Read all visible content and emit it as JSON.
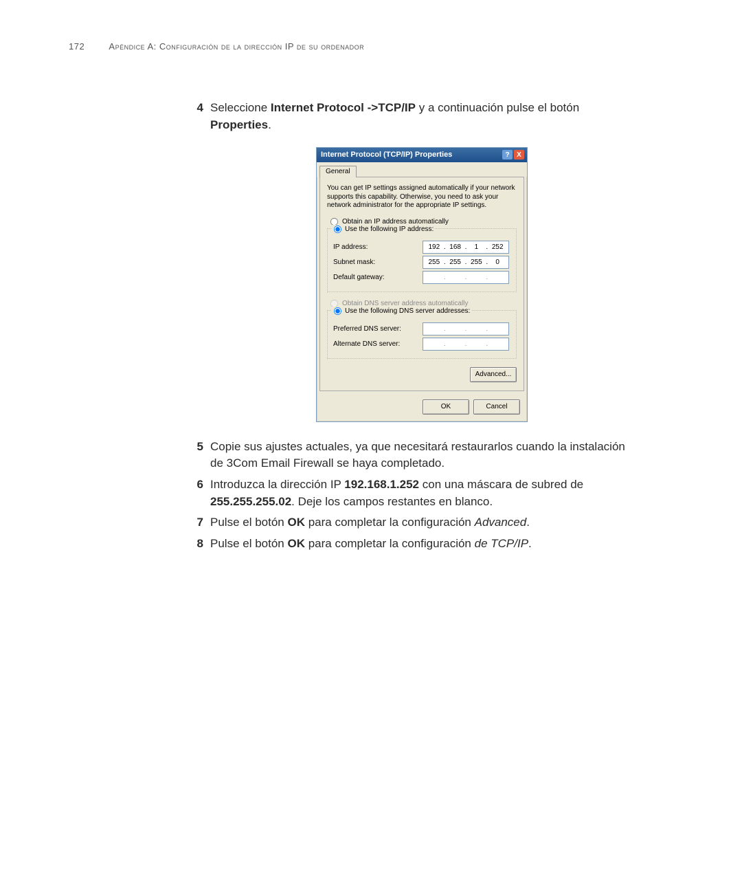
{
  "header": {
    "page_number": "172",
    "title": "Apéndice A: Configuración de la dirección IP de su ordenador"
  },
  "steps": {
    "s4": {
      "num": "4",
      "pre": "Seleccione ",
      "bold1": "Internet Protocol ->TCP/IP",
      "mid": " y a continuación pulse el botón ",
      "bold2": "Properties",
      "post": "."
    },
    "s5": {
      "num": "5",
      "text": "Copie sus ajustes actuales, ya que necesitará restaurarlos cuando la instalación de 3Com Email Firewall se haya completado."
    },
    "s6": {
      "num": "6",
      "pre": "Introduzca la dirección IP ",
      "bold1": "192.168.1.252",
      "mid": " con una máscara de subred de ",
      "bold2": "255.255.255.02",
      "post": ". Deje los campos restantes en blanco."
    },
    "s7": {
      "num": "7",
      "pre": "Pulse el botón ",
      "bold": "OK",
      "mid": " para completar la configuración ",
      "ital": "Advanced",
      "post": "."
    },
    "s8": {
      "num": "8",
      "pre": "Pulse el botón ",
      "bold": "OK",
      "mid": " para completar la configuración ",
      "ital": "de TCP/IP",
      "post": "."
    }
  },
  "dialog": {
    "title": "Internet Protocol (TCP/IP) Properties",
    "help_glyph": "?",
    "close_glyph": "X",
    "tab": "General",
    "description": "You can get IP settings assigned automatically if your network supports this capability. Otherwise, you need to ask your network administrator for the appropriate IP settings.",
    "radio_obtain_ip": "Obtain an IP address automatically",
    "radio_use_ip": "Use the following IP address:",
    "ip_label": "IP address:",
    "subnet_label": "Subnet mask:",
    "gateway_label": "Default gateway:",
    "ip_octets": [
      "192",
      "168",
      "1",
      "252"
    ],
    "subnet_octets": [
      "255",
      "255",
      "255",
      "0"
    ],
    "radio_obtain_dns": "Obtain DNS server address automatically",
    "radio_use_dns": "Use the following DNS server addresses:",
    "pref_dns_label": "Preferred DNS server:",
    "alt_dns_label": "Alternate DNS server:",
    "advanced_btn": "Advanced...",
    "ok_btn": "OK",
    "cancel_btn": "Cancel"
  }
}
